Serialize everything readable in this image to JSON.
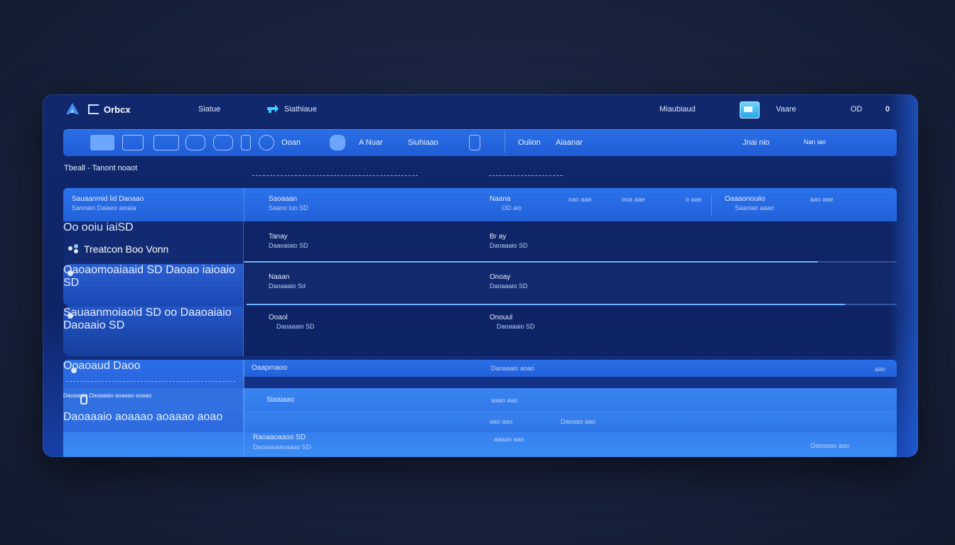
{
  "topbar": {
    "brand": "Orbcx",
    "nav1": "Siatue",
    "nav2": "Siathiaue",
    "right_label": "Miaubiaud",
    "user": "Vaare",
    "status": "OD",
    "count": "0"
  },
  "toolbar": {
    "item1": "Ooan",
    "item2": "A Nuar",
    "item3": "Siuhiaao",
    "item4": "Oulion",
    "item5": "Aiaanar",
    "item6": "Jnai nio",
    "item7": "Nan iao"
  },
  "section": {
    "title": "Tbeall - Tanont noaot"
  },
  "header_row": {
    "side_title": "Sauaanmid lid Daoaao",
    "side_sub": "Sannaio Daiaeo aioaia",
    "col1_title": "Saoaaan",
    "col1_sub": "Saano iuo SD",
    "col2_title": "Naana",
    "col2_sub": "OD aio",
    "col3": "oao aae",
    "col4": "ooa aae",
    "col5": "o aae",
    "col6_title": "Oaaaonouiio",
    "col6_sub": "Saaoiao aaao",
    "col7": "aao aae"
  },
  "rows": [
    {
      "side_tag": "Oo ooiu iaiSD",
      "side_title": "Treatcon Boo Vonn",
      "col1_title": "Tanay",
      "col1_sub": "Daaoaiaio SD",
      "col2_title": "Br ay",
      "col2_sub": "Daoaaaio SD",
      "progress": 0.88
    },
    {
      "side_title": "Oaoaomoaiaaid SD",
      "side_sub": "Daoao iaioaio SD",
      "col1_title": "Naaan",
      "col1_sub": "Daoaaaio Sd",
      "col2_title": "Onoay",
      "col2_sub": "Daoaaaio SD",
      "progress": 0.92
    },
    {
      "side_title": "Sauaanmoiaoid SD oo",
      "side_sub": "Daaoaiaio Daoaaio SD",
      "col1_title": "Ooaol",
      "col1_sub": "Daoaaaio SD",
      "col2_title": "Onouul",
      "col2_sub": "Daoaaaio SD"
    }
  ],
  "group": {
    "side_title": "Ooaoaud",
    "side_right": "Daoo",
    "col1": "Oaaprnaoo",
    "col2": "Daoaaaio aoao",
    "col_right": "aao"
  },
  "detail_rows": [
    {
      "side": "Daoaaaio Daoaaaio aoaaao aoaao",
      "col1": "Siaaiaao",
      "col2": "aaao aao"
    },
    {
      "side": "Daoaaaio aoaaao aoaaao",
      "side_right": "aoao",
      "col1": "aao aao",
      "col2": "Daoaao aao"
    },
    {
      "col1": "Raoaaoaaoo SD",
      "col1_sub": "Daoaaoaaoaaao SD",
      "col2": "aaaao aao",
      "col_right": "Daoaaao aao"
    }
  ],
  "colors": {
    "accent": "#2a6fe6",
    "panel": "#0f2567",
    "background": "#1a2440"
  }
}
